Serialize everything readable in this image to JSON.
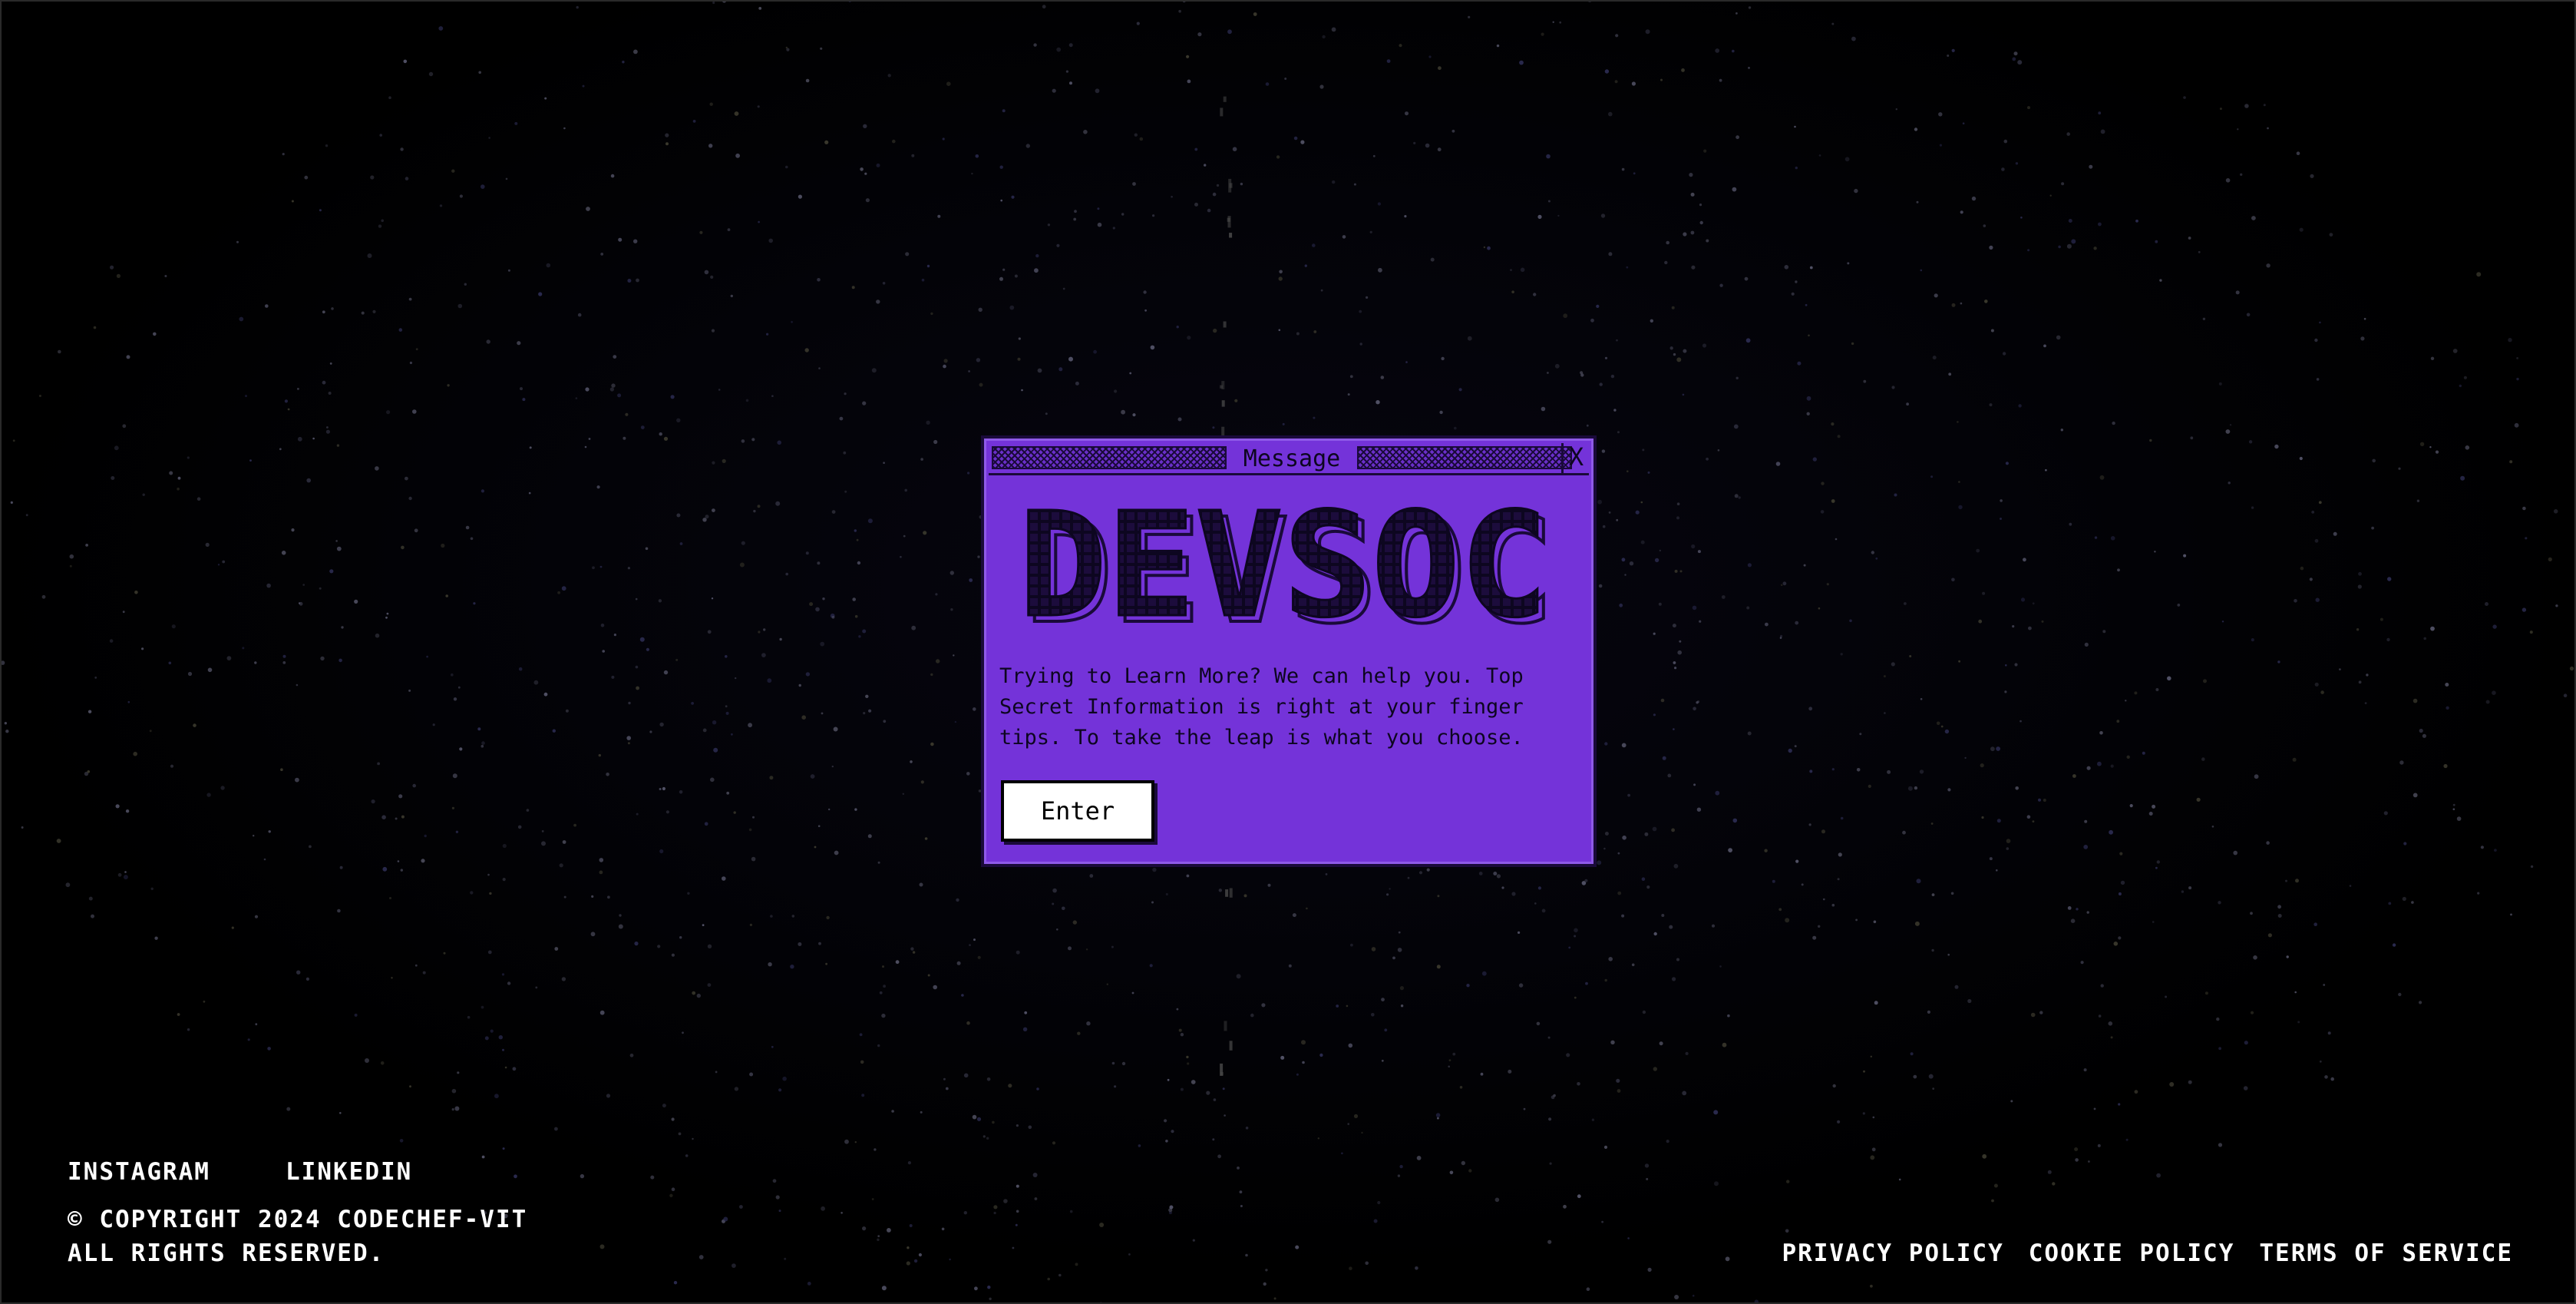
{
  "dialog": {
    "title": "Message",
    "close_label": "X",
    "logo_text": "DEVSOC",
    "message": "Trying to Learn More? We can help you. Top Secret Information is right at your finger tips. To take the leap is what you choose.",
    "enter_label": "Enter"
  },
  "footer": {
    "social": {
      "instagram": "INSTAGRAM",
      "linkedin": "LINKEDIN"
    },
    "copyright": "© COPYRIGHT 2024 CODECHEF-VIT",
    "rights": "ALL RIGHTS RESERVED.",
    "legal": {
      "privacy": "PRIVACY POLICY",
      "cookie": "COOKIE POLICY",
      "terms": "TERMS OF SERVICE"
    }
  },
  "colors": {
    "dialog_bg": "#7433d9",
    "dialog_ink": "#1a0a3a",
    "page_bg": "#000000",
    "footer_text": "#ffffff"
  }
}
